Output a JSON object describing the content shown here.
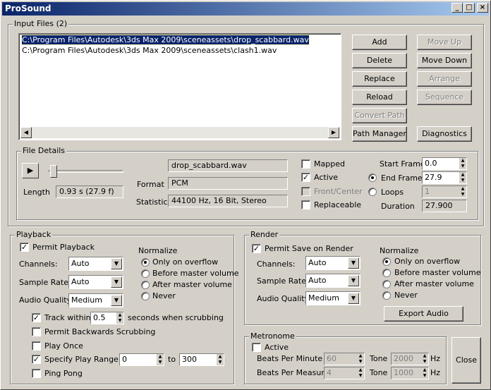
{
  "window": {
    "title": "ProSound",
    "min": "_",
    "max": "□",
    "close": "×"
  },
  "input_files": {
    "legend": "Input Files (2)",
    "files": [
      "C:\\Program Files\\Autodesk\\3ds Max 2009\\sceneassets\\drop_scabbard.wav",
      "C:\\Program Files\\Autodesk\\3ds Max 2009\\sceneassets\\clash1.wav"
    ],
    "buttons": {
      "add": "Add",
      "delete": "Delete",
      "replace": "Replace",
      "reload": "Reload",
      "convert_path": "Convert Path",
      "path_manager": "Path Manager",
      "move_up": "Move Up",
      "move_down": "Move Down",
      "arrange": "Arrange",
      "sequence": "Sequence",
      "diagnostics": "Diagnostics"
    }
  },
  "file_details": {
    "legend": "File Details",
    "filename": "drop_scabbard.wav",
    "format_label": "Format",
    "format": "PCM",
    "statistics_label": "Statistics",
    "statistics": "44100 Hz, 16 Bit, Stereo",
    "length_label": "Length",
    "length": "0.93 s (27.9 f)",
    "mapped": "Mapped",
    "active": "Active",
    "front_center": "Front/Center",
    "replaceable": "Replaceable",
    "start_frame_label": "Start Frame",
    "start_frame": "0.0",
    "end_frame_label": "End Frame",
    "end_frame": "27.9",
    "loops_label": "Loops",
    "loops": "1",
    "duration_label": "Duration",
    "duration": "27.900",
    "slider_position": 0.0
  },
  "playback": {
    "legend": "Playback",
    "permit_playback": "Permit Playback",
    "channels_label": "Channels:",
    "channels": "Auto",
    "sample_rate_label": "Sample Rate:",
    "sample_rate": "Auto",
    "audio_quality_label": "Audio Quality:",
    "audio_quality": "Medium",
    "normalize_label": "Normalize",
    "normalize_options": [
      "Only on overflow",
      "Before master volume",
      "After master volume",
      "Never"
    ],
    "track_within": "Track within",
    "track_value": "0.5",
    "track_suffix": "seconds when scrubbing",
    "permit_backwards": "Permit Backwards Scrubbing",
    "play_once": "Play Once",
    "specify_play_range": "Specify Play Range",
    "range_from": "0",
    "range_to_label": "to",
    "range_to": "300",
    "ping_pong": "Ping Pong"
  },
  "render": {
    "legend": "Render",
    "permit_save": "Permit Save on Render",
    "channels_label": "Channels:",
    "channels": "Auto",
    "sample_rate_label": "Sample Rate:",
    "sample_rate": "Auto",
    "audio_quality_label": "Audio Quality:",
    "audio_quality": "Medium",
    "normalize_label": "Normalize",
    "normalize_options": [
      "Only on overflow",
      "Before master volume",
      "After master volume",
      "Never"
    ],
    "export_audio": "Export Audio"
  },
  "metronome": {
    "legend": "Metronome",
    "active": "Active",
    "bpm_label": "Beats Per Minute",
    "bpm": "60",
    "bpmeasure_label": "Beats Per Measure",
    "bpmeasure": "4",
    "tone_label": "Tone",
    "tone1": "2000",
    "tone2": "1000",
    "hz": "Hz"
  },
  "close": "Close"
}
